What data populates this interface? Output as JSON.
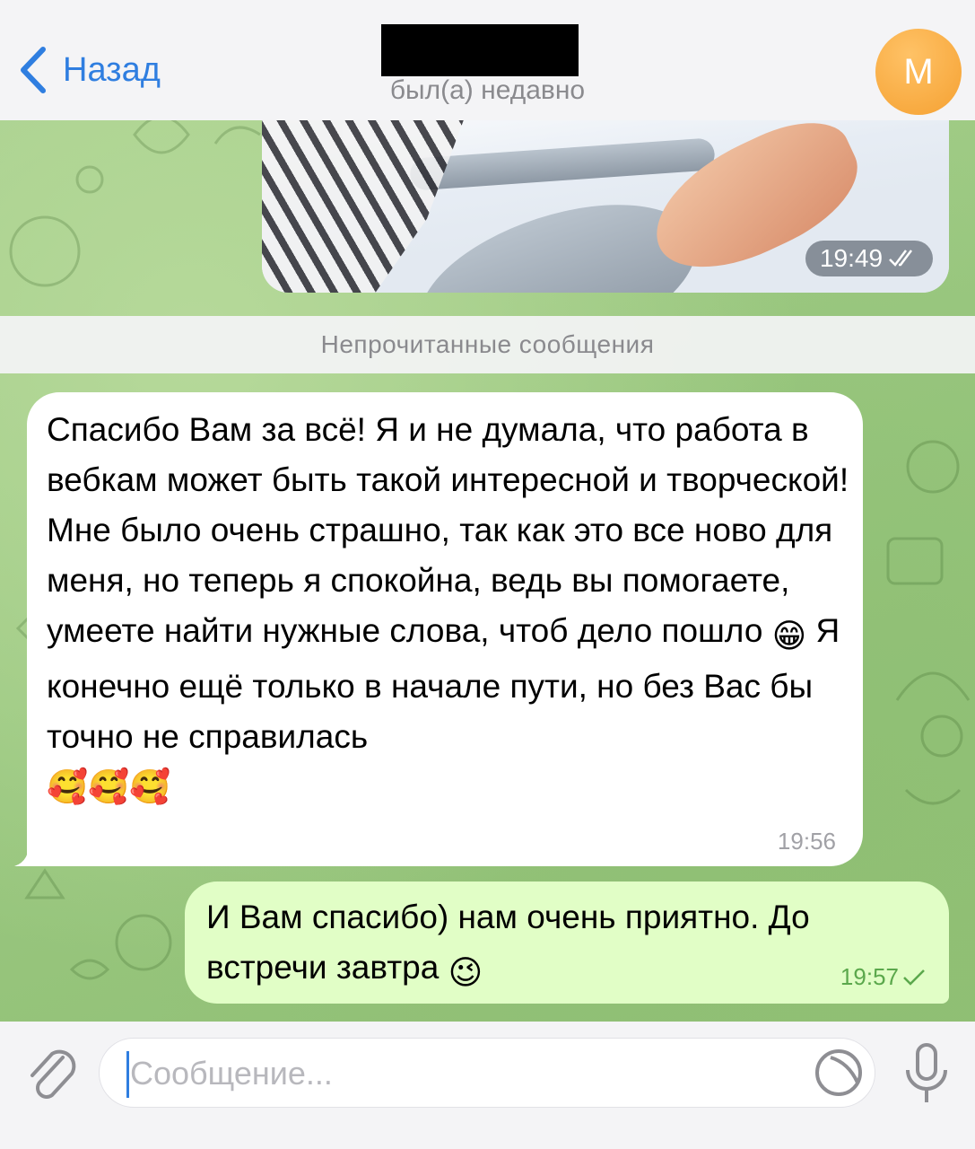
{
  "header": {
    "back_label": "Назад",
    "status": "был(а) недавно",
    "avatar_letter": "М"
  },
  "colors": {
    "accent": "#2f7ee0",
    "avatar": "#f5a132",
    "incoming_bubble": "#ffffff",
    "outgoing_bubble": "#e1fec6",
    "wallpaper": "#9fca86"
  },
  "messages": {
    "photo": {
      "time": "19:49"
    },
    "unread_divider": "Непрочитанные сообщения",
    "incoming": {
      "text_part1": "Спасибо Вам за всё! Я и не думала, что работа в вебкам может быть такой интересной и творческой! Мне было очень страшно, так как это все ново для меня, но теперь я спокойна, ведь вы помогаете, умеете найти нужные слова, чтоб дело пошло",
      "emoji_mid": "😁",
      "text_part2": "Я конечно ещё только в начале пути, но без Вас бы точно не справилась",
      "emoji_end": "🥰🥰🥰",
      "time": "19:56"
    },
    "outgoing": {
      "text": "И Вам спасибо) нам очень приятно. До встречи завтра",
      "emoji": "😉",
      "time": "19:57"
    }
  },
  "composer": {
    "placeholder": "Сообщение..."
  }
}
